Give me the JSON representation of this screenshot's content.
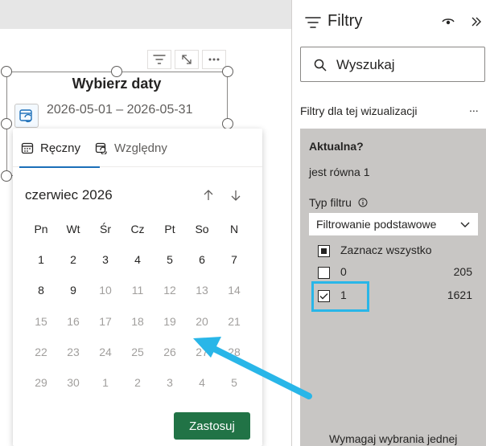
{
  "slicer": {
    "title": "Wybierz daty",
    "range": "2026-05-01 – 2026-05-31",
    "icon": "calendar-refresh-icon"
  },
  "visual_header": {
    "icons": [
      "filter-icon",
      "focus-mode-icon",
      "more-options-icon"
    ]
  },
  "popup": {
    "tabs": [
      {
        "label": "Ręczny",
        "icon": "calendar-icon",
        "selected": true
      },
      {
        "label": "Względny",
        "icon": "calendar-refresh-icon",
        "selected": false
      }
    ],
    "month": "czerwiec 2026",
    "weekdays": [
      "Pn",
      "Wt",
      "Śr",
      "Cz",
      "Pt",
      "So",
      "N"
    ],
    "weeks": [
      [
        {
          "d": "1",
          "e": true
        },
        {
          "d": "2",
          "e": true
        },
        {
          "d": "3",
          "e": true
        },
        {
          "d": "4",
          "e": true
        },
        {
          "d": "5",
          "e": true
        },
        {
          "d": "6",
          "e": true
        },
        {
          "d": "7",
          "e": true
        }
      ],
      [
        {
          "d": "8",
          "e": true
        },
        {
          "d": "9",
          "e": true
        },
        {
          "d": "10",
          "e": false
        },
        {
          "d": "11",
          "e": false
        },
        {
          "d": "12",
          "e": false
        },
        {
          "d": "13",
          "e": false
        },
        {
          "d": "14",
          "e": false
        }
      ],
      [
        {
          "d": "15",
          "e": false
        },
        {
          "d": "16",
          "e": false
        },
        {
          "d": "17",
          "e": false
        },
        {
          "d": "18",
          "e": false
        },
        {
          "d": "19",
          "e": false
        },
        {
          "d": "20",
          "e": false
        },
        {
          "d": "21",
          "e": false
        }
      ],
      [
        {
          "d": "22",
          "e": false
        },
        {
          "d": "23",
          "e": false
        },
        {
          "d": "24",
          "e": false
        },
        {
          "d": "25",
          "e": false
        },
        {
          "d": "26",
          "e": false
        },
        {
          "d": "27",
          "e": false
        },
        {
          "d": "28",
          "e": false
        }
      ],
      [
        {
          "d": "29",
          "e": false
        },
        {
          "d": "30",
          "e": false
        },
        {
          "d": "1",
          "e": false
        },
        {
          "d": "2",
          "e": false
        },
        {
          "d": "3",
          "e": false
        },
        {
          "d": "4",
          "e": false
        },
        {
          "d": "5",
          "e": false
        }
      ]
    ],
    "apply_label": "Zastosuj"
  },
  "filters": {
    "title": "Filtry",
    "search_placeholder": "Wyszukaj",
    "section_label": "Filtry dla tej wizualizacji",
    "section_more": "...",
    "card": {
      "title": "Aktualna?",
      "condition": "jest równa 1",
      "filter_type_label": "Typ filtru",
      "filter_type_value": "Filtrowanie podstawowe",
      "options": [
        {
          "label": "Zaznacz wszystko",
          "count": "",
          "state": "partial"
        },
        {
          "label": "0",
          "count": "205",
          "state": "unchecked"
        },
        {
          "label": "1",
          "count": "1621",
          "state": "checked"
        }
      ],
      "require_text": "Wymagaj wybrania jednej"
    }
  },
  "colors": {
    "accent_blue": "#1b6fb8",
    "apply_green": "#217346",
    "highlight_cyan": "#29b6e8",
    "card_grey": "#c8c6c4"
  }
}
